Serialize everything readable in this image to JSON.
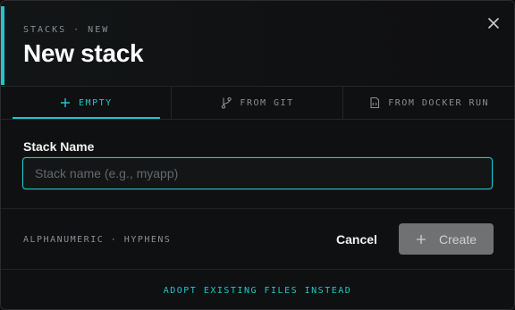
{
  "header": {
    "kicker": "STACKS · NEW",
    "title": "New stack"
  },
  "tabs": [
    {
      "label": "EMPTY",
      "icon": "plus-icon",
      "active": true
    },
    {
      "label": "FROM GIT",
      "icon": "git-branch-icon",
      "active": false
    },
    {
      "label": "FROM DOCKER RUN",
      "icon": "file-code-icon",
      "active": false
    }
  ],
  "form": {
    "field_label": "Stack Name",
    "placeholder": "Stack name (e.g., myapp)",
    "value": ""
  },
  "footer": {
    "hint": "ALPHANUMERIC · HYPHENS",
    "cancel_label": "Cancel",
    "create_label": "Create",
    "adopt_link": "ADOPT EXISTING FILES INSTEAD"
  },
  "colors": {
    "accent": "#23c4c9",
    "background": "#0f1011",
    "create_button": "#7a7c7e"
  }
}
